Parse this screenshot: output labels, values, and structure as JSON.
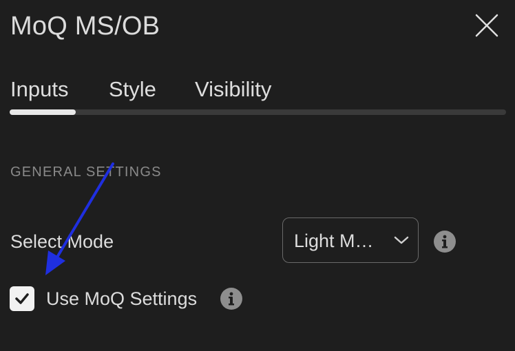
{
  "dialog": {
    "title": "MoQ MS/OB",
    "close_icon": "close-icon"
  },
  "tabs": [
    {
      "label": "Inputs",
      "active": true
    },
    {
      "label": "Style",
      "active": false
    },
    {
      "label": "Visibility",
      "active": false
    }
  ],
  "section": {
    "heading": "GENERAL SETTINGS"
  },
  "select_mode": {
    "label": "Select Mode",
    "value": "Light M…",
    "icon": "chevron-down-icon",
    "info_icon": "info-icon"
  },
  "use_moq": {
    "label": "Use MoQ Settings",
    "checked": true,
    "check_icon": "checkmark-icon",
    "info_icon": "info-icon"
  },
  "colors": {
    "background": "#1e1e1e",
    "annotation_arrow": "#1f2fe0",
    "tab_indicator": "#e8e8e8",
    "tab_track": "#3a3a3a"
  }
}
